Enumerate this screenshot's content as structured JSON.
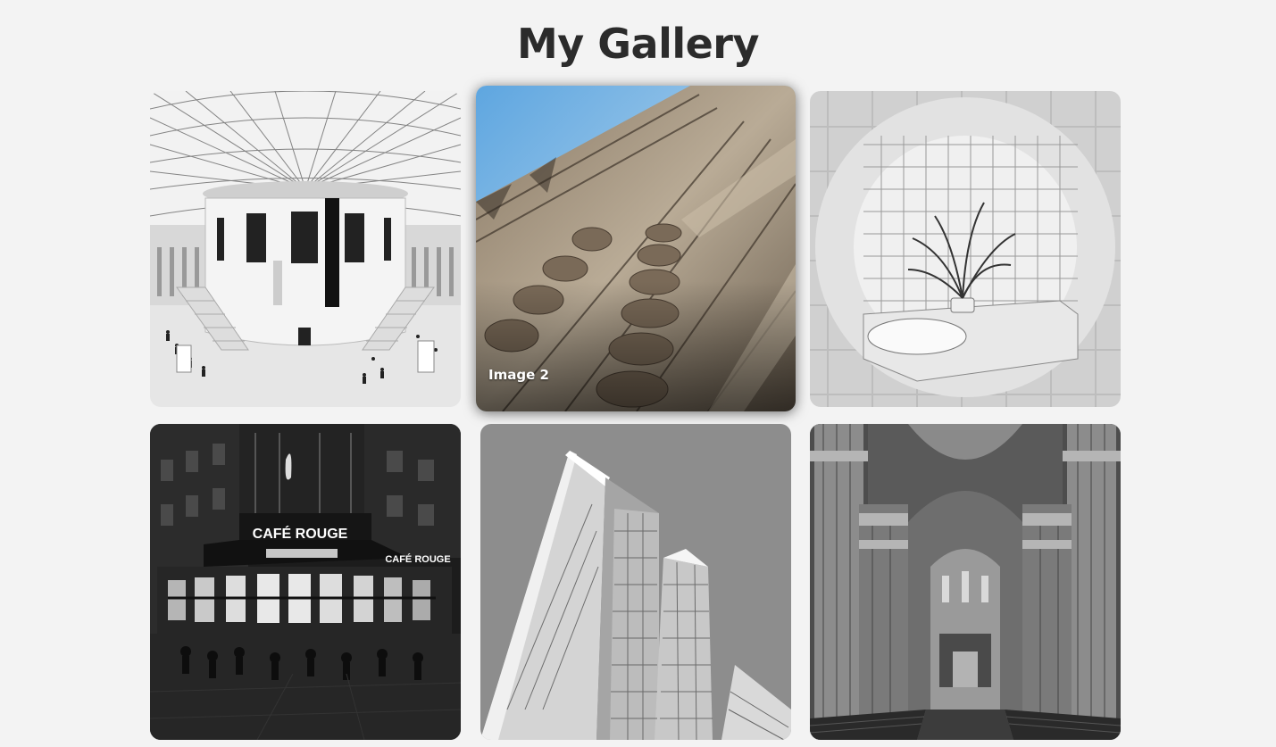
{
  "header": {
    "title": "My Gallery"
  },
  "gallery": {
    "items": [
      {
        "subject": "domed atrium with lattice glass roof",
        "caption": ""
      },
      {
        "subject": "ornate carved stone facade",
        "caption": "Image 2"
      },
      {
        "subject": "tiled room with plant seen through round opening",
        "caption": ""
      },
      {
        "subject": "cafe corner building at night",
        "caption": ""
      },
      {
        "subject": "glass skyscrapers",
        "caption": ""
      },
      {
        "subject": "cathedral interior with columns",
        "caption": ""
      }
    ],
    "signs": {
      "cafe_main": "CAFÉ ROUGE",
      "cafe_side": "CAFÉ ROUGE"
    }
  },
  "colors": {
    "background": "#f3f3f3",
    "title": "#2b2b2b",
    "caption": "#ffffff"
  }
}
